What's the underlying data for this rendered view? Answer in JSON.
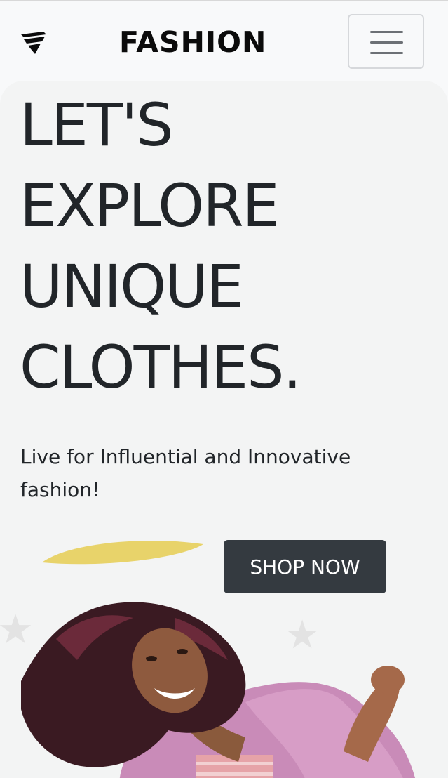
{
  "navbar": {
    "brand_icon": "shield-logo-icon",
    "brand_name": "FASHION",
    "toggler_icon": "hamburger-menu-icon"
  },
  "hero": {
    "headline_lines": [
      "LET'S",
      "EXPLORE",
      "UNIQUE",
      "CLOTHES."
    ],
    "tagline": "Live for Influential and Innovative fashion!",
    "cta_label": "SHOP NOW",
    "decor_icons": [
      "star-icon",
      "star-icon",
      "yellow-brush-stroke"
    ],
    "image_subject": "model-photo"
  },
  "colors": {
    "navbar_bg": "#f8f9fa",
    "hero_bg": "#f3f4f4",
    "text": "#212529",
    "button_bg": "#343a40",
    "button_text": "#ffffff",
    "accent_yellow": "#e8d36a",
    "star": "#e3e3e3"
  }
}
